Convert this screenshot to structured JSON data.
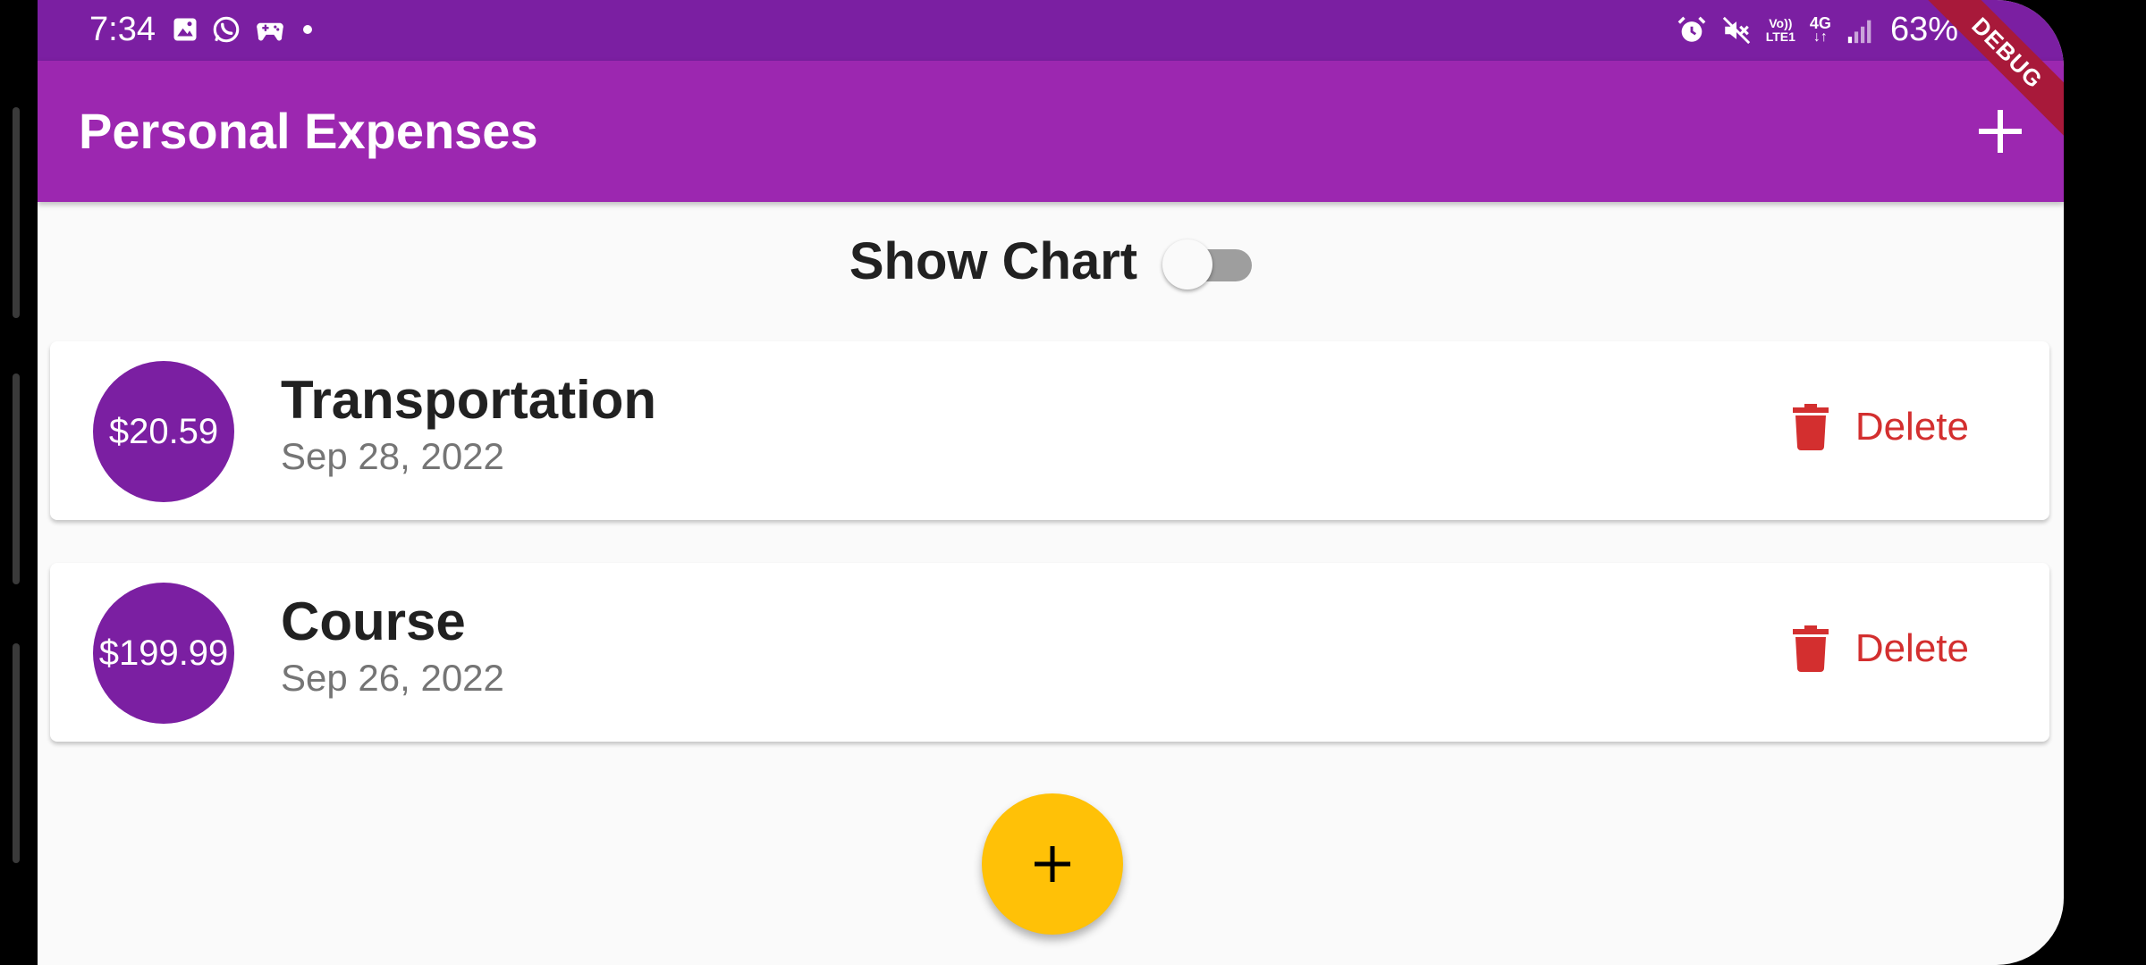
{
  "status_bar": {
    "time": "7:34",
    "battery": "63%",
    "network_top": "Vo))",
    "network_bottom": "LTE1",
    "network_type": "4G",
    "left_icons": [
      "gallery-icon",
      "whatsapp-icon",
      "game-icon",
      "dot-icon"
    ],
    "right_icons": [
      "alarm-icon",
      "mute-icon",
      "signal-icon",
      "battery-icon"
    ]
  },
  "debug_banner": "DEBUG",
  "app_bar": {
    "title": "Personal Expenses",
    "add_icon": "plus-icon"
  },
  "chart_toggle": {
    "label": "Show Chart",
    "enabled": false
  },
  "transactions": [
    {
      "amount": "$20.59",
      "title": "Transportation",
      "date": "Sep 28, 2022",
      "delete_label": "Delete",
      "delete_icon": "trash-icon"
    },
    {
      "amount": "$199.99",
      "title": "Course",
      "date": "Sep 26, 2022",
      "delete_label": "Delete",
      "delete_icon": "trash-icon"
    }
  ],
  "fab": {
    "icon": "plus-icon"
  },
  "colors": {
    "status_bar": "#7b1fa2",
    "app_bar": "#9c27b0",
    "avatar": "#7b1fa2",
    "delete": "#d32f2f",
    "fab": "#ffc107",
    "background": "#fafafa"
  }
}
